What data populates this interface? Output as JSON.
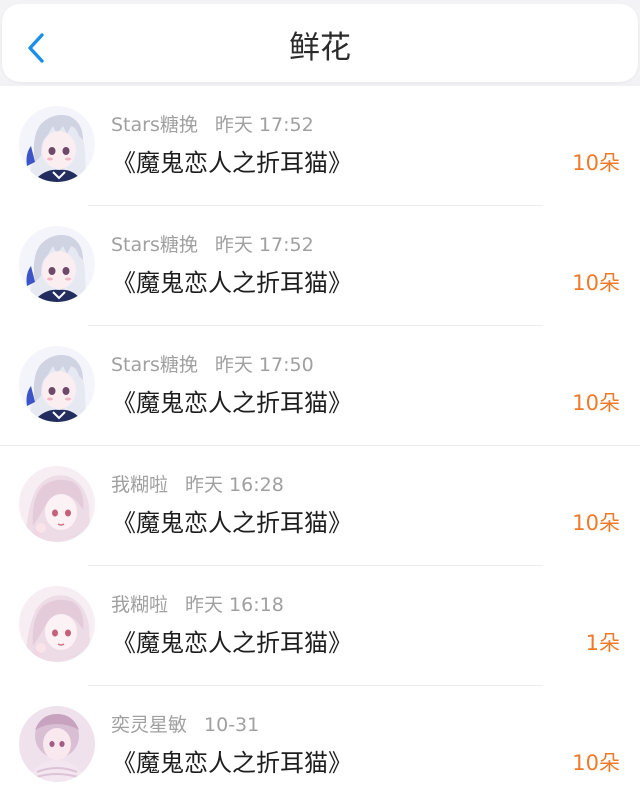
{
  "header": {
    "title": "鲜花",
    "back_icon": "chevron-left-icon",
    "accent_color": "#1a8ee8"
  },
  "colors": {
    "count": "#f07a2c",
    "meta": "#a0a0a0",
    "title": "#1e1e1e"
  },
  "gifts": [
    {
      "user": "Stars糖挽",
      "time": "昨天 17:52",
      "work": "《魔鬼恋人之折耳猫》",
      "count": "10朵",
      "avatar": "avatar-white-hair-girl"
    },
    {
      "user": "Stars糖挽",
      "time": "昨天 17:52",
      "work": "《魔鬼恋人之折耳猫》",
      "count": "10朵",
      "avatar": "avatar-white-hair-girl"
    },
    {
      "user": "Stars糖挽",
      "time": "昨天 17:50",
      "work": "《魔鬼恋人之折耳猫》",
      "count": "10朵",
      "avatar": "avatar-white-hair-girl"
    },
    {
      "user": "我糊啦",
      "time": "昨天 16:28",
      "work": "《魔鬼恋人之折耳猫》",
      "count": "10朵",
      "avatar": "avatar-pink-hair-girl"
    },
    {
      "user": "我糊啦",
      "time": "昨天 16:18",
      "work": "《魔鬼恋人之折耳猫》",
      "count": "1朵",
      "avatar": "avatar-pink-hair-girl"
    },
    {
      "user": "奕灵星敏",
      "time": "10-31",
      "work": "《魔鬼恋人之折耳猫》",
      "count": "10朵",
      "avatar": "avatar-lace-dress-girl"
    }
  ]
}
